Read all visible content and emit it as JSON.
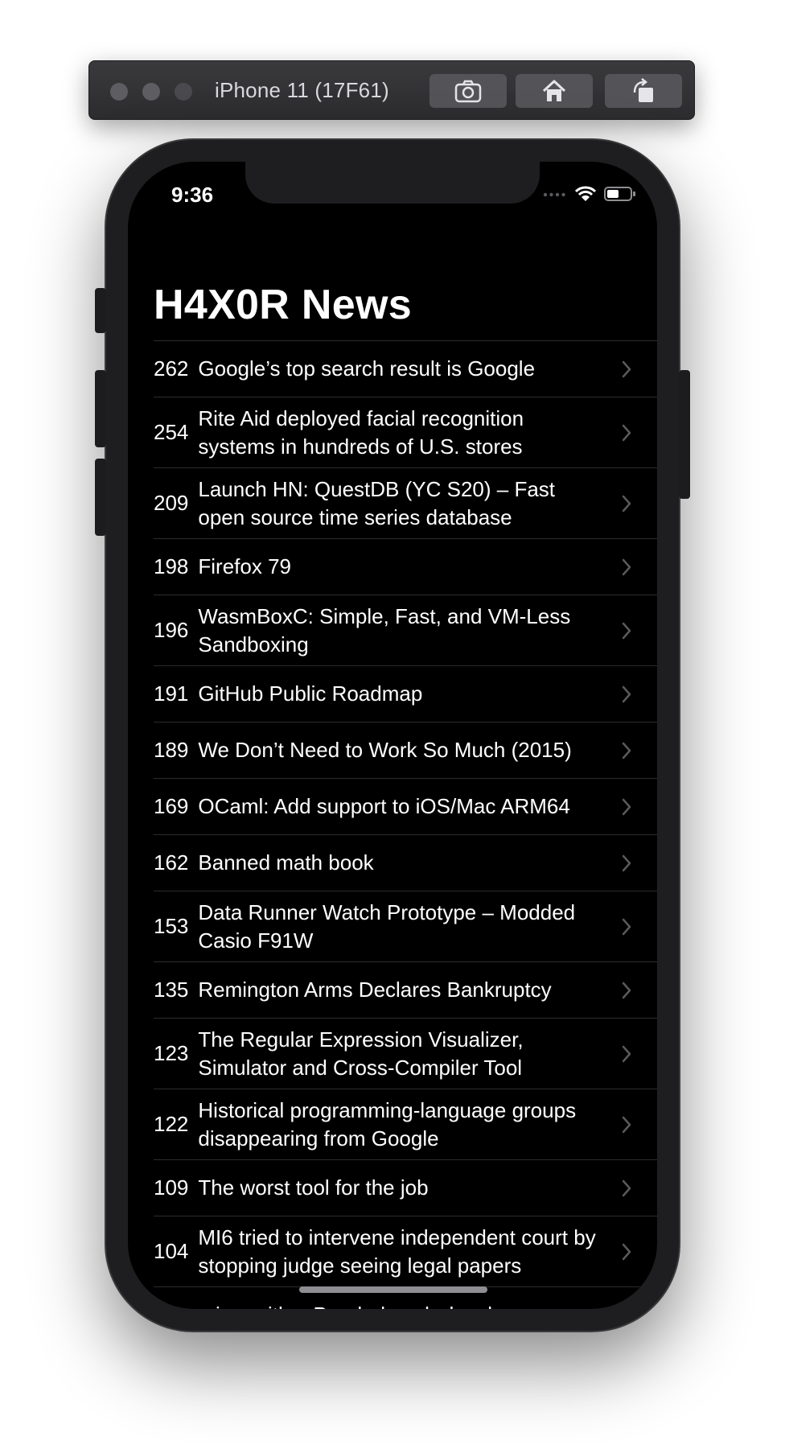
{
  "toolbar": {
    "device_title": "iPhone 11 (17F61)",
    "buttons": [
      {
        "icon": "camera-icon"
      },
      {
        "icon": "home-icon"
      },
      {
        "icon": "rotate-icon"
      }
    ]
  },
  "status_bar": {
    "time": "9:36",
    "icons": [
      "cellular-icon",
      "wifi-icon",
      "battery-icon"
    ]
  },
  "app": {
    "title": "H4X0R News"
  },
  "stories": [
    {
      "points": "262",
      "title": "Google’s top search result is Google"
    },
    {
      "points": "254",
      "title": "Rite Aid deployed facial recognition systems in hundreds of U.S. stores"
    },
    {
      "points": "209",
      "title": "Launch HN: QuestDB (YC S20) – Fast open source time series database"
    },
    {
      "points": "198",
      "title": "Firefox 79"
    },
    {
      "points": "196",
      "title": "WasmBoxC: Simple, Fast, and VM-Less Sandboxing"
    },
    {
      "points": "191",
      "title": "GitHub Public Roadmap"
    },
    {
      "points": "189",
      "title": "We Don’t Need to Work So Much (2015)"
    },
    {
      "points": "169",
      "title": "OCaml: Add support to iOS/Mac ARM64"
    },
    {
      "points": "162",
      "title": "Banned math book"
    },
    {
      "points": "153",
      "title": "Data Runner Watch Prototype – Modded Casio F91W"
    },
    {
      "points": "135",
      "title": "Remington Arms Declares Bankruptcy"
    },
    {
      "points": "123",
      "title": "The Regular Expression Visualizer, Simulator and Cross-Compiler Tool"
    },
    {
      "points": "122",
      "title": "Historical programming-language groups disappearing from Google"
    },
    {
      "points": "109",
      "title": "The worst tool for the job"
    },
    {
      "points": "104",
      "title": "MI6 tried to intervene independent court by stopping judge seeing legal papers"
    },
    {
      "points": "",
      "title": "Interview with a Pornhub web developer"
    }
  ]
}
